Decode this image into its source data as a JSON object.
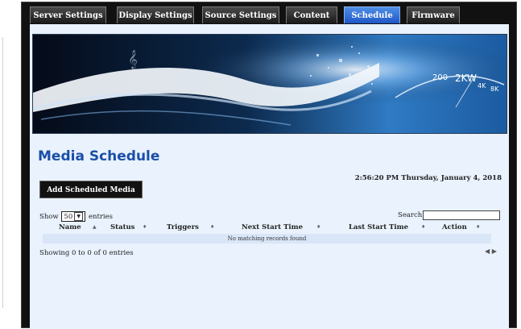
{
  "tabs": [
    {
      "label": "Server Settings",
      "active": false
    },
    {
      "label": "Display Settings",
      "active": false
    },
    {
      "label": "Source Settings",
      "active": false
    },
    {
      "label": "Content",
      "active": false
    },
    {
      "label": "Schedule",
      "active": true
    },
    {
      "label": "Firmware",
      "active": false
    }
  ],
  "banner": {
    "meter_labels": [
      "200",
      "2KW",
      "4K",
      "8K"
    ]
  },
  "page_title": "Media Schedule",
  "add_button": "Add Scheduled Media",
  "datetime": "2:56:20 PM Thursday, January 4, 2018",
  "length_menu": {
    "prefix": "Show",
    "value": "50",
    "suffix": "entries"
  },
  "search": {
    "label": "Search:",
    "value": ""
  },
  "table": {
    "columns": [
      "Name",
      "Status",
      "Triggers",
      "Next Start Time",
      "Last Start Time",
      "Action"
    ],
    "empty_message": "No matching records found"
  },
  "info": "Showing 0 to 0 of 0 entries",
  "pager": {
    "prev": "◀",
    "next": "▶"
  },
  "colors": {
    "accent": "#1a4fa8",
    "active_tab": "#2e6bd6",
    "content_bg": "#e9f2fd",
    "frame": "#111111"
  }
}
